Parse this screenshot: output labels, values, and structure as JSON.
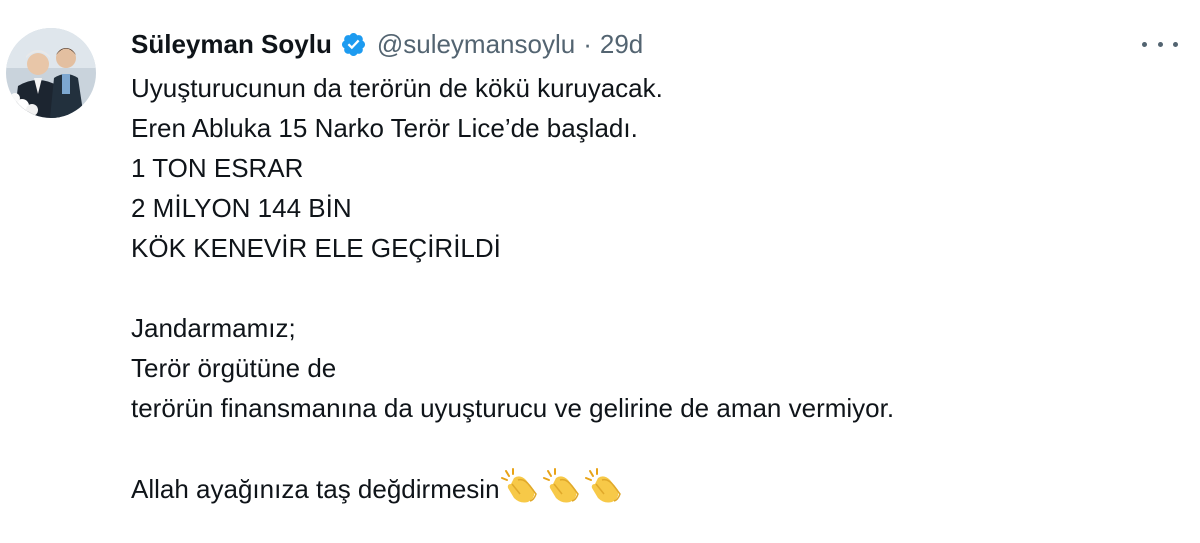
{
  "tweet": {
    "display_name": "Süleyman Soylu",
    "handle": "@suleymansoylu",
    "separator": "·",
    "time": "29d",
    "lines": [
      "Uyuşturucunun da terörün de kökü kuruyacak.",
      "Eren Abluka 15 Narko Terör Lice’de başladı.",
      "1 TON ESRAR",
      "2 MİLYON 144 BİN",
      "KÖK KENEVİR ELE GEÇİRİLDİ",
      "",
      "Jandarmamız;",
      "Terör örgütüne de",
      "terörün finansmanına da uyuşturucu ve gelirine de aman vermiyor.",
      "",
      "Allah ayağınıza taş değdirmesin"
    ],
    "emoji": [
      "clapping-hands",
      "clapping-hands",
      "clapping-hands"
    ]
  },
  "icons": {
    "verified": "verified-badge-icon",
    "more": "more-icon",
    "verified_color": "#1d9bf0",
    "clap_color": "#f7c948"
  }
}
